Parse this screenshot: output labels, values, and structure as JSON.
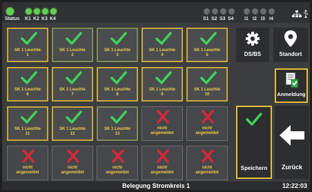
{
  "status": {
    "status_label": "Status",
    "k_labels": [
      "K1",
      "K2",
      "K3",
      "K4"
    ],
    "s_labels": [
      "S1",
      "S2",
      "S3",
      "S4"
    ],
    "i_labels": [
      "I1",
      "I2",
      "I3",
      "I4"
    ],
    "colors": {
      "led_on": "#5fcf4f",
      "led_off": "#6a6c6e"
    }
  },
  "tiles": [
    {
      "label": "SK 1 Leuchte 1",
      "l1": "SK 1 Leuchte",
      "l2": "1",
      "state": "assigned"
    },
    {
      "label": "SK 1 Leuchte 2",
      "l1": "SK 1 Leuchte",
      "l2": "2",
      "state": "assigned"
    },
    {
      "label": "SK 1 Leuchte 3",
      "l1": "SK 1 Leuchte",
      "l2": "3",
      "state": "assigned"
    },
    {
      "label": "SK 1 Leuchte 4",
      "l1": "SK 1 Leuchte",
      "l2": "4",
      "state": "assigned"
    },
    {
      "label": "SK 1 Leuchte 5",
      "l1": "SK 1 Leuchte",
      "l2": "5",
      "state": "assigned"
    },
    {
      "label": "SK 1 Leuchte 6",
      "l1": "SK 1 Leuchte",
      "l2": "6",
      "state": "assigned"
    },
    {
      "label": "SK 1 Leuchte 7",
      "l1": "SK 1 Leuchte",
      "l2": "7",
      "state": "assigned"
    },
    {
      "label": "SK 1 Leuchte 8",
      "l1": "SK 1 Leuchte",
      "l2": "8",
      "state": "assigned"
    },
    {
      "label": "SK 1 Leuchte 9",
      "l1": "SK 1 Leuchte",
      "l2": "9",
      "state": "assigned"
    },
    {
      "label": "SK 1 Leuchte 10",
      "l1": "SK 1 Leuchte",
      "l2": "10",
      "state": "assigned"
    },
    {
      "label": "SK 1 Leuchte 11",
      "l1": "SK 1 Leuchte",
      "l2": "11",
      "state": "assigned"
    },
    {
      "label": "SK 1 Leuchte 12",
      "l1": "SK 1 Leuchte",
      "l2": "12",
      "state": "assigned"
    },
    {
      "label": "SK 1 Leuchte 13",
      "l1": "SK 1 Leuchte",
      "l2": "13",
      "state": "assigned"
    },
    {
      "label": "nicht angemeldet",
      "l1": "nicht",
      "l2": "angemeldet",
      "state": "not-registered"
    },
    {
      "label": "nicht angemeldet",
      "l1": "nicht",
      "l2": "angemeldet",
      "state": "not-registered"
    },
    {
      "label": "nicht angemeldet",
      "l1": "nicht",
      "l2": "angemeldet",
      "state": "not-registered"
    },
    {
      "label": "nicht angemeldet",
      "l1": "nicht",
      "l2": "angemeldet",
      "state": "not-registered"
    },
    {
      "label": "nicht angemeldet",
      "l1": "nicht",
      "l2": "angemeldet",
      "state": "not-registered"
    },
    {
      "label": "nicht angemeldet",
      "l1": "nicht",
      "l2": "angemeldet",
      "state": "not-registered"
    },
    {
      "label": "nicht angemeldet",
      "l1": "nicht",
      "l2": "angemeldet",
      "state": "not-registered"
    }
  ],
  "buttons": {
    "dsbs": {
      "label": "DS/BS",
      "icon": "gear-icon"
    },
    "standort": {
      "label": "Standort",
      "icon": "location-pin-icon"
    },
    "anmeldung": {
      "label": "Anmeldung",
      "icon": "register-document-icon"
    },
    "speichern": {
      "label": "Speichern",
      "icon": "checkmark-icon"
    },
    "zurueck": {
      "label": "Zurück",
      "icon": "arrow-left-icon"
    }
  },
  "footer": {
    "title": "Belegung Stromkreis 1",
    "time": "12:22:03"
  },
  "colors": {
    "check": "#3fd25b",
    "cross": "#d8283a",
    "tile_border": "#c7a83a",
    "label_text": "#f0d24a"
  }
}
